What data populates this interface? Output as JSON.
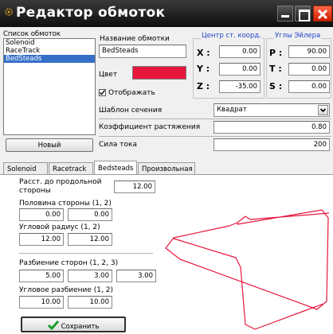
{
  "window": {
    "title": "Редактор обмоток"
  },
  "coil_list": {
    "label": "Список обмоток",
    "items": [
      "Solenoid",
      "RaceTrack",
      "BedSteads"
    ],
    "selected_index": 2
  },
  "name": {
    "label": "Название обмотки",
    "value": "BedSteads"
  },
  "color": {
    "label": "Цвет",
    "value": "#e8163c"
  },
  "show": {
    "label": "Отображать",
    "checked": true
  },
  "center": {
    "header": "Центр ст. коорд.",
    "x_label": "X :",
    "y_label": "Y :",
    "z_label": "Z :",
    "x": "0.00",
    "y": "0.00",
    "z": "-35.00"
  },
  "euler": {
    "header": "Углы Эйлера",
    "p_label": "P :",
    "t_label": "T :",
    "s_label": "S :",
    "p": "90.00",
    "t": "0.00",
    "s": "0.00"
  },
  "profile": {
    "label": "Шаблон сечения",
    "value": "Квадрат"
  },
  "stretch": {
    "label": "Коэффициент растяжения",
    "value": "0.80"
  },
  "current": {
    "label": "Сила тока",
    "value": "200"
  },
  "new_button": "Новый",
  "tabs": [
    "Solenoid",
    "Racetrack",
    "Bedsteads",
    "Произвольная"
  ],
  "active_tab": 2,
  "params": {
    "long_side_label": "Расст. до продольной стороны",
    "long_side": "12.00",
    "half_side_label": "Половина стороны (1, 2)",
    "half_side": [
      "0.00",
      "0.00"
    ],
    "corner_radius_label": "Угловой радиус (1, 2)",
    "corner_radius": [
      "12.00",
      "12.00"
    ],
    "side_split_label": "Разбиение сторон (1, 2, 3)",
    "side_split": [
      "5.00",
      "3.00",
      "3.00"
    ],
    "corner_split_label": "Угловое разбиение (1, 2)",
    "corner_split": [
      "10.00",
      "10.00"
    ]
  },
  "save_button": "Сохранить",
  "colors": {
    "accent": "#2044c8",
    "preview_line": "#e8163c",
    "selection": "#3470c8"
  }
}
